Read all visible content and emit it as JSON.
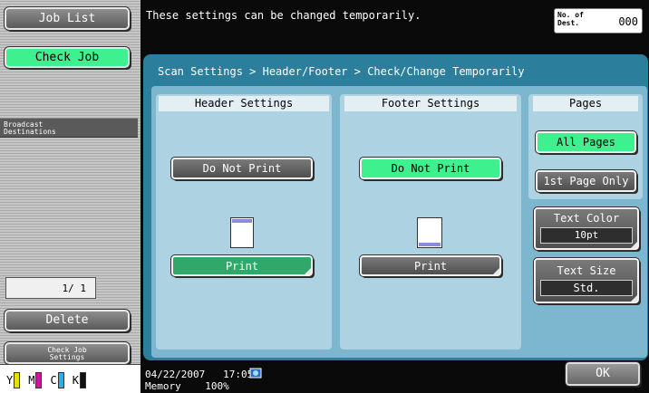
{
  "sidebar": {
    "job_list": "Job List",
    "check_job": "Check Job",
    "broadcast_destinations": "Broadcast\nDestinations",
    "page_indicator": "1/ 1",
    "delete": "Delete",
    "check_job_settings": "Check Job\nSettings",
    "toner": [
      {
        "letter": "Y",
        "color": "#e8e000"
      },
      {
        "letter": "M",
        "color": "#d0169a"
      },
      {
        "letter": "C",
        "color": "#1fb6e6"
      },
      {
        "letter": "K",
        "color": "#111111"
      }
    ]
  },
  "top": {
    "message": "These settings can be changed temporarily.",
    "dest_label": "No. of\nDest.",
    "dest_count": "000"
  },
  "main": {
    "breadcrumb": "Scan Settings > Header/Footer > Check/Change Temporarily",
    "header": {
      "title": "Header Settings",
      "do_not_print": "Do Not Print",
      "print": "Print"
    },
    "footer": {
      "title": "Footer Settings",
      "do_not_print": "Do Not Print",
      "print": "Print"
    },
    "pages": {
      "title": "Pages",
      "all_pages": "All Pages",
      "first_page_only": "1st Page Only"
    },
    "text_color": {
      "label": "Text Color",
      "value": "10pt"
    },
    "text_size": {
      "label": "Text Size",
      "value": "Std."
    }
  },
  "bottom": {
    "date": "04/22/2007",
    "time": "17:05",
    "memory_label": "Memory",
    "memory_value": "100%",
    "ok": "OK"
  }
}
